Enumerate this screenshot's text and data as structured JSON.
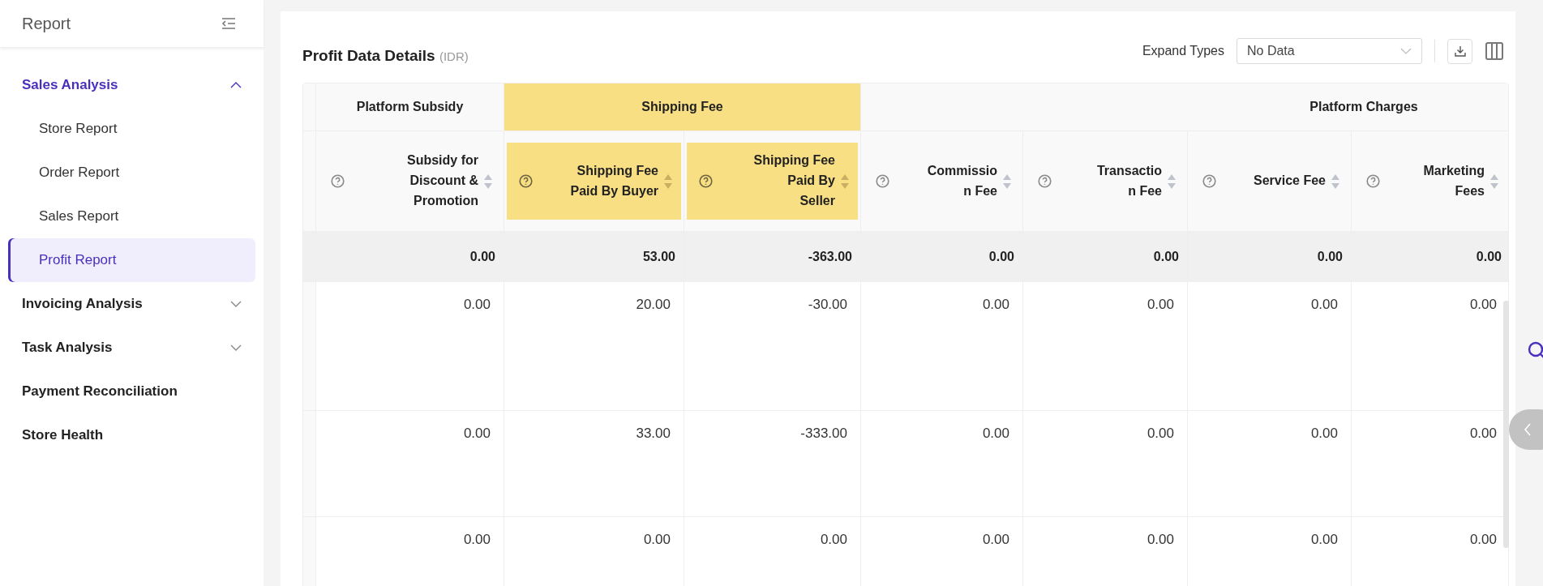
{
  "sidebar": {
    "title": "Report",
    "items": [
      {
        "label": "Sales Analysis",
        "selected": true,
        "kind": "group",
        "expanded": true,
        "children": [
          {
            "label": "Store Report",
            "selected": false
          },
          {
            "label": "Order Report",
            "selected": false
          },
          {
            "label": "Sales Report",
            "selected": false
          },
          {
            "label": "Profit Report",
            "selected": true
          }
        ]
      },
      {
        "label": "Invoicing Analysis",
        "selected": false,
        "kind": "group",
        "expanded": false
      },
      {
        "label": "Task Analysis",
        "selected": false,
        "kind": "group",
        "expanded": false
      },
      {
        "label": "Payment Reconciliation",
        "selected": false,
        "kind": "link"
      },
      {
        "label": "Store Health",
        "selected": false,
        "kind": "link"
      }
    ]
  },
  "section": {
    "title": "Profit Data Details",
    "currency": "(IDR)"
  },
  "toolbar": {
    "expand_label": "Expand Types",
    "expand_select": {
      "value": "No Data"
    }
  },
  "table": {
    "groups": [
      {
        "label": "Platform Subsidy",
        "highlighted": false,
        "columns": [
          {
            "label": "Subsidy for Discount & Promotion",
            "highlighted": false
          }
        ]
      },
      {
        "label": "Shipping Fee",
        "highlighted": true,
        "columns": [
          {
            "label": "Shipping Fee Paid By Buyer",
            "highlighted": true
          },
          {
            "label": "Shipping Fee Paid By Seller",
            "highlighted": true
          }
        ]
      },
      {
        "label": "Platform Charges",
        "highlighted": false,
        "columns": [
          {
            "label": "Commissio n Fee",
            "highlighted": false
          },
          {
            "label": "Transactio n Fee",
            "highlighted": false
          },
          {
            "label": "Service Fee",
            "highlighted": false
          },
          {
            "label": "Marketing Fees",
            "highlighted": false
          }
        ]
      }
    ],
    "summary_row": [
      "0.00",
      "53.00",
      "-363.00",
      "0.00",
      "0.00",
      "0.00",
      "0.00"
    ],
    "rows": [
      [
        "0.00",
        "20.00",
        "-30.00",
        "0.00",
        "0.00",
        "0.00",
        "0.00"
      ],
      [
        "0.00",
        "33.00",
        "-333.00",
        "0.00",
        "0.00",
        "0.00",
        "0.00"
      ],
      [
        "0.00",
        "0.00",
        "0.00",
        "0.00",
        "0.00",
        "0.00",
        "0.00"
      ]
    ]
  }
}
